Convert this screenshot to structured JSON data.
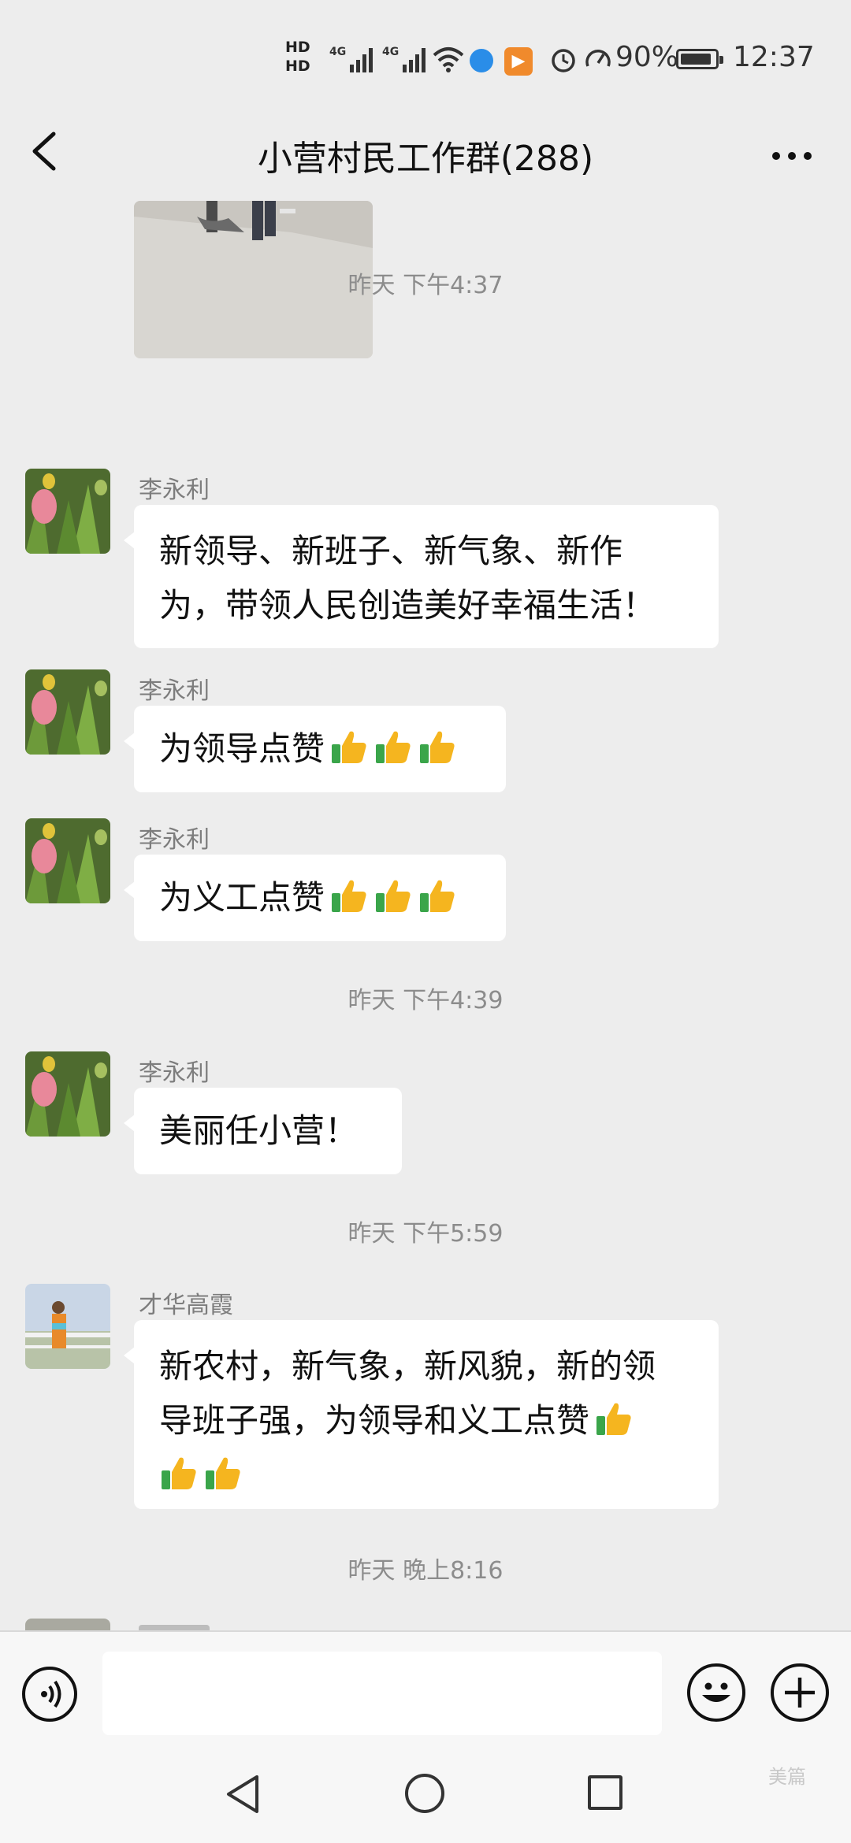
{
  "status_bar": {
    "hd1": "HD",
    "hd2": "HD",
    "sig1_label": "4G",
    "sig2_label": "4G",
    "battery": "90%",
    "battery_level": 0.9,
    "time": "12:37"
  },
  "header": {
    "title": "小营村民工作群(288)"
  },
  "chat": {
    "timestamps": [
      "昨天 下午4:37",
      "昨天 下午4:39",
      "昨天 下午5:59",
      "昨天 晚上8:16"
    ],
    "messages": [
      {
        "sender": "李永利",
        "lines": [
          "新领导、新班子、新气象、新作",
          "为，带领人民创造美好幸福生活！"
        ]
      },
      {
        "sender": "李永利",
        "text": "为领导点赞"
      },
      {
        "sender": "李永利",
        "text": "为义工点赞"
      },
      {
        "sender": "李永利",
        "text": "美丽任小营！"
      },
      {
        "sender": "才华高霞",
        "lines": [
          "新农村，新气象，新风貌，新的领",
          "导班子强，为领导和义工点赞"
        ]
      }
    ]
  },
  "input": {
    "placeholder": ""
  },
  "watermark": "美篇",
  "colors": {
    "background": "#ededed",
    "bubble": "#ffffff",
    "timestamp": "#8c8c8c",
    "sender": "#7d7d7d"
  }
}
